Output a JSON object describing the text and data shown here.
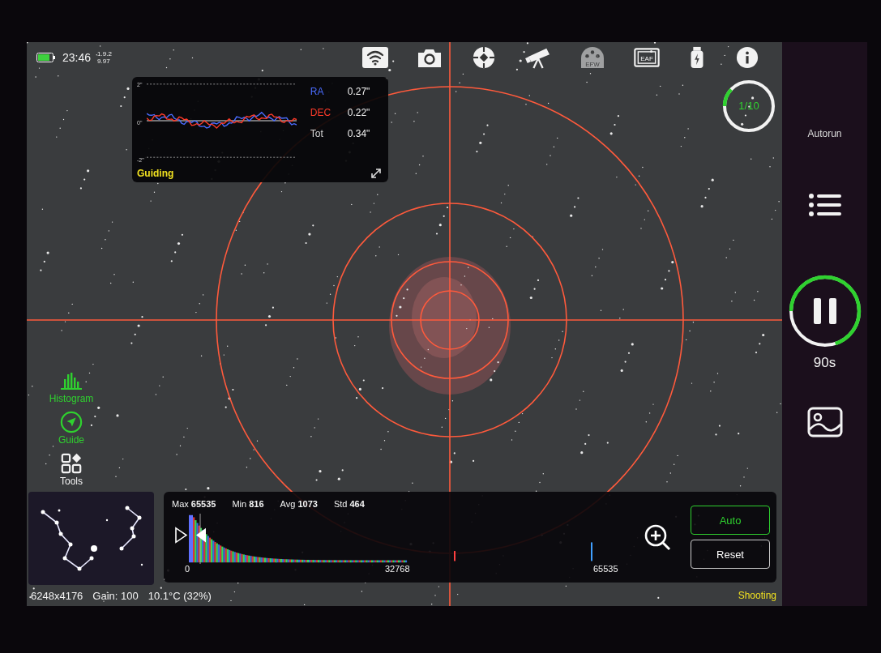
{
  "status": {
    "time": "23:46",
    "version": "1.9.2",
    "version_2": "9.97"
  },
  "toolbar": [
    {
      "kind": "wifi",
      "disabled": false
    },
    {
      "kind": "camera",
      "disabled": false
    },
    {
      "kind": "guider",
      "disabled": false
    },
    {
      "kind": "telescope",
      "disabled": false
    },
    {
      "kind": "efw",
      "label": "EFW",
      "disabled": true
    },
    {
      "kind": "eaf",
      "label": "EAF",
      "disabled": false
    },
    {
      "kind": "power",
      "disabled": false
    },
    {
      "kind": "info",
      "disabled": false
    }
  ],
  "guiding": {
    "title": "Guiding",
    "yticks": [
      "2\"",
      "0\"",
      "-2\""
    ],
    "stats": [
      {
        "label": "RA",
        "value": "0.27\"",
        "color": "#4a6cff"
      },
      {
        "label": "DEC",
        "value": "0.22\"",
        "color": "#ff3b2a"
      },
      {
        "label": "Tot",
        "value": "0.34\"",
        "color": "#d8d8d8"
      }
    ]
  },
  "sequence": {
    "text": "1/10",
    "level": 0.12
  },
  "tools": [
    {
      "kind": "histogram",
      "label": "Histogram",
      "active": true
    },
    {
      "kind": "guide",
      "label": "Guide",
      "active": true
    },
    {
      "kind": "tools",
      "label": "Tools",
      "active": false
    }
  ],
  "histogram": {
    "stats": [
      {
        "label": "Max",
        "value": "65535"
      },
      {
        "label": "Min",
        "value": "816"
      },
      {
        "label": "Avg",
        "value": "1073"
      },
      {
        "label": "Std",
        "value": "464"
      }
    ],
    "axis": [
      "0",
      "32768",
      "65535"
    ],
    "buttons": [
      {
        "label": "Auto",
        "selected": true
      },
      {
        "label": "Reset",
        "selected": false
      }
    ]
  },
  "info_bar": {
    "resolution": "6248x4176",
    "gain": "Gain: 100",
    "temperature": "10.1°C (32%)",
    "state": "Shooting"
  },
  "sidebar": {
    "autorun": "Autorun",
    "exposure": {
      "level": 0.7,
      "text": "90s"
    }
  }
}
